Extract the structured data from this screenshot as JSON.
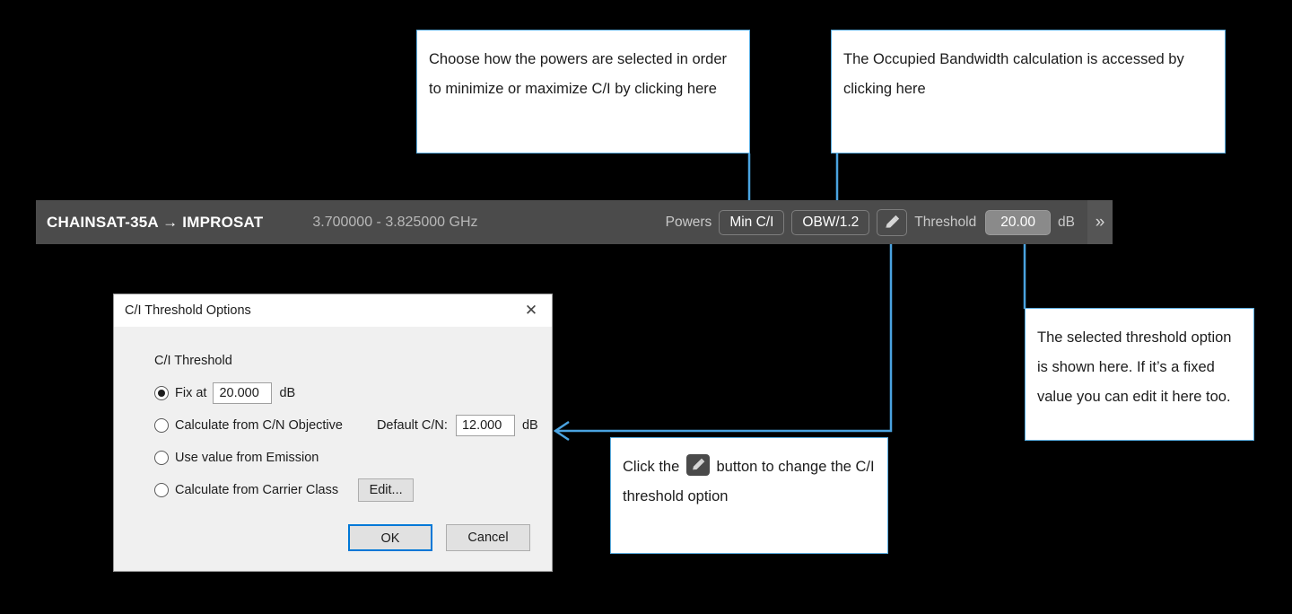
{
  "callouts": {
    "powers": "Choose how the powers are selected in order to minimize or maximize C/I by clicking here",
    "obw": "The Occupied Bandwidth calculation is accessed by clicking here",
    "threshold": "The selected threshold option is shown here. If it’s a fixed value you can edit it here too.",
    "pencil_before": "Click the",
    "pencil_after": "button to change the C/I threshold option"
  },
  "toolbar": {
    "title": "CHAINSAT-35A → IMPROSAT",
    "frequency": "3.700000 - 3.825000 GHz",
    "powers_label": "Powers",
    "powers_mode": "Min C/I",
    "obw_button": "OBW/1.2",
    "edit_icon": "pencil-icon",
    "threshold_label": "Threshold",
    "threshold_value": "20.00",
    "threshold_unit": "dB",
    "overflow_icon": "»"
  },
  "dialog": {
    "title": "C/I Threshold Options",
    "close_icon": "✕",
    "group_label": "C/I Threshold",
    "options": [
      {
        "label": "Fix at",
        "selected": true
      },
      {
        "label": "Calculate from C/N Objective",
        "selected": false
      },
      {
        "label": "Use value from Emission",
        "selected": false
      },
      {
        "label": "Calculate from Carrier Class",
        "selected": false
      }
    ],
    "fix_at_value": "20.000",
    "fix_at_unit": "dB",
    "default_cn_label": "Default C/N:",
    "default_cn_value": "12.000",
    "default_cn_unit": "dB",
    "edit_button": "Edit...",
    "ok_button": "OK",
    "cancel_button": "Cancel"
  },
  "colors": {
    "accent": "#4aa3e0",
    "toolbar_bg": "#4b4b4b",
    "dialog_bg": "#f0f0f0",
    "focus_blue": "#0078d7"
  }
}
